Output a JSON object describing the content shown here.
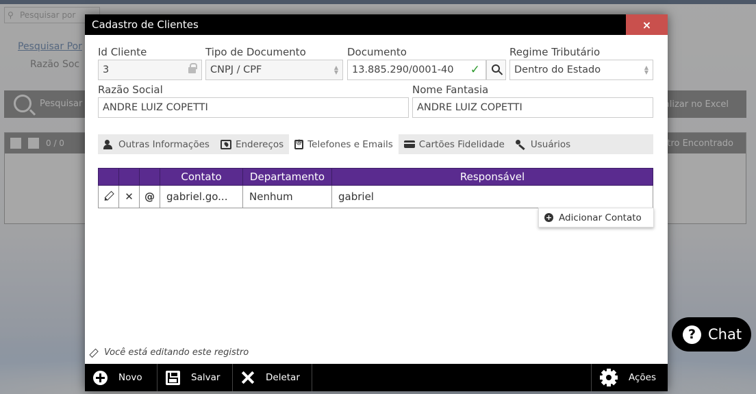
{
  "background": {
    "search_placeholder": "Pesquisar por",
    "search_by_link": "Pesquisar Por",
    "search_sub": "Razão Soc",
    "search_button": "Pesquisar",
    "excel_button": "sualizar no Excel",
    "pager": "0 / 0",
    "grid_status": "tro Encontrado"
  },
  "modal": {
    "title": "Cadastro de Clientes",
    "close_symbol": "×",
    "fields": {
      "id_cliente": {
        "label": "Id Cliente",
        "value": "3"
      },
      "tipo_documento": {
        "label": "Tipo de Documento",
        "value": "CNPJ / CPF"
      },
      "documento": {
        "label": "Documento",
        "value": "13.885.290/0001-40"
      },
      "regime_tributario": {
        "label": "Regime Tributário",
        "value": "Dentro do Estado"
      },
      "razao_social": {
        "label": "Razão Social",
        "value": "ANDRE LUIZ COPETTI"
      },
      "nome_fantasia": {
        "label": "Nome Fantasia",
        "value": "ANDRE LUIZ COPETTI"
      }
    },
    "tabs": [
      {
        "label": "Outras Informações",
        "icon": "users-icon"
      },
      {
        "label": "Endereços",
        "icon": "map-icon"
      },
      {
        "label": "Telefones e Emails",
        "icon": "phone-book-icon",
        "active": true
      },
      {
        "label": "Cartões Fidelidade",
        "icon": "credit-card-icon"
      },
      {
        "label": "Usuários",
        "icon": "key-icon"
      }
    ],
    "table": {
      "headers": [
        "Contato",
        "Departamento",
        "Responsável"
      ],
      "rows": [
        {
          "contato": "gabriel.go...",
          "departamento": "Nenhum",
          "responsavel": "gabriel",
          "icon_delete": "✕",
          "icon_email": "@"
        }
      ]
    },
    "add_contact_label": "Adicionar Contato",
    "editing_notice": "Você está editando este registro",
    "footer": {
      "novo": "Novo",
      "salvar": "Salvar",
      "deletar": "Deletar",
      "acoes": "Ações"
    }
  },
  "chat": {
    "label": "Chat",
    "icon_symbol": "?"
  }
}
